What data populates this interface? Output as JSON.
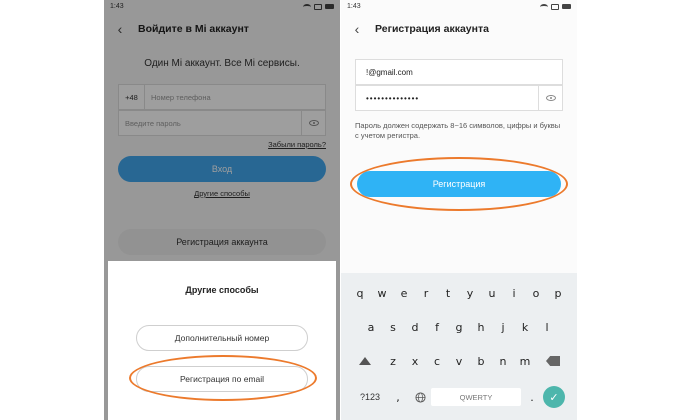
{
  "left": {
    "status_time": "1:43",
    "title": "Войдите в Mi аккаунт",
    "tagline": "Один Mi аккаунт. Все Mi сервисы.",
    "phone_prefix": "+48",
    "phone_placeholder": "Номер телефона",
    "password_placeholder": "Введите пароль",
    "forgot_password": "Забыли пароль?",
    "login_button": "Вход",
    "other_methods_link": "Другие способы",
    "register_button": "Регистрация аккаунта",
    "sheet": {
      "title": "Другие способы",
      "additional_number": "Дополнительный номер",
      "register_email": "Регистрация по email"
    }
  },
  "right": {
    "status_time": "1:43",
    "title": "Регистрация аккаунта",
    "email_value": "!@gmail.com",
    "password_value": "••••••••••••••",
    "hint": "Пароль должен содержать 8~16 символов, цифры и буквы с учетом регистра.",
    "register_button": "Регистрация"
  },
  "keyboard": {
    "row1": [
      "q",
      "w",
      "e",
      "r",
      "t",
      "y",
      "u",
      "i",
      "o",
      "p"
    ],
    "row2": [
      "a",
      "s",
      "d",
      "f",
      "g",
      "h",
      "j",
      "k",
      "l"
    ],
    "row3": [
      "z",
      "x",
      "c",
      "v",
      "b",
      "n",
      "m"
    ],
    "num_key": "?123",
    "period_key": ".",
    "comma_key": ",",
    "space_label": "QWERTY"
  },
  "colors": {
    "accent_blue": "#41a7ee",
    "register_blue": "#2fb3f5",
    "highlight_orange": "#ec7a2c",
    "enter_teal": "#4db6ac"
  }
}
